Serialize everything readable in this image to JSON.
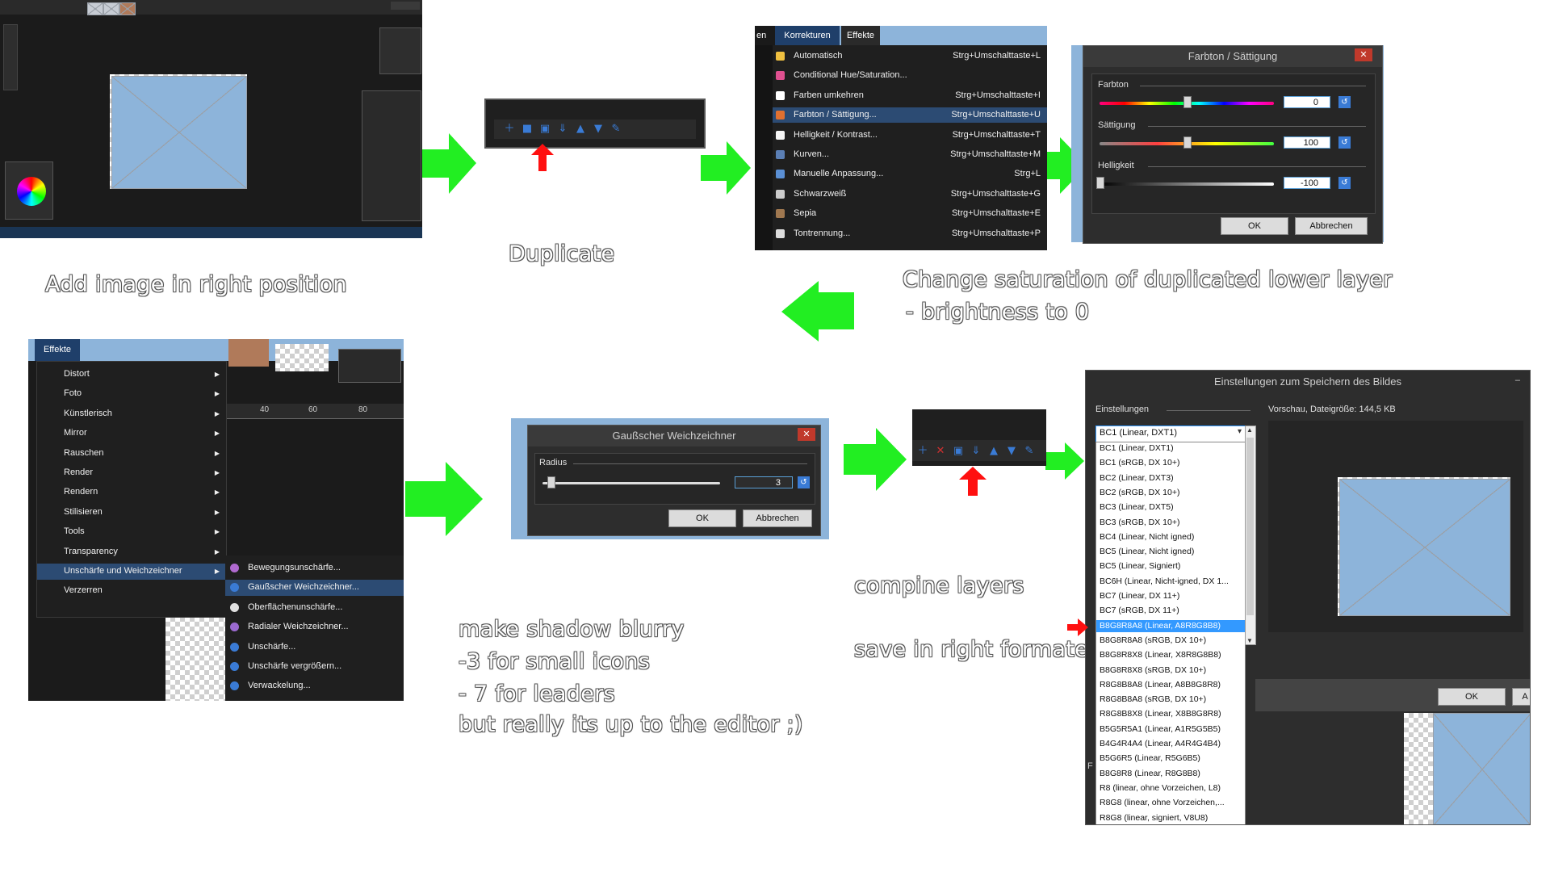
{
  "captions": {
    "add_image": "Add image in right position",
    "duplicate": "Duplicate",
    "change_saturation_1": "Change saturation of duplicated lower layer",
    "change_saturation_2": "- brightness to 0",
    "blur_1": "make shadow blurry",
    "blur_2": "-3 for small icons",
    "blur_3": "- 7 for leaders",
    "blur_4": "but really its up to the editor ;)",
    "combine": "compine layers",
    "save": "save in right formate"
  },
  "corrections_menu": {
    "tabs": [
      "en",
      "Korrekturen",
      "Effekte"
    ],
    "items": [
      {
        "label": "Automatisch",
        "shortcut": "Strg+Umschalttaste+L",
        "icon": "auto-level-icon",
        "color": "#f0c040"
      },
      {
        "label": "Conditional Hue/Saturation...",
        "shortcut": "",
        "icon": "color-wheel-icon",
        "color": "#e05090"
      },
      {
        "label": "Farben umkehren",
        "shortcut": "Strg+Umschalttaste+I",
        "icon": "invert-icon",
        "color": "#ffffff"
      },
      {
        "label": "Farbton / Sättigung...",
        "shortcut": "Strg+Umschalttaste+U",
        "icon": "hue-icon",
        "color": "#e07030"
      },
      {
        "label": "Helligkeit / Kontrast...",
        "shortcut": "Strg+Umschalttaste+T",
        "icon": "sun-icon",
        "color": "#f5f5f5"
      },
      {
        "label": "Kurven...",
        "shortcut": "Strg+Umschalttaste+M",
        "icon": "curves-icon",
        "color": "#5b7fb5"
      },
      {
        "label": "Manuelle Anpassung...",
        "shortcut": "Strg+L",
        "icon": "levels-icon",
        "color": "#5b90d5"
      },
      {
        "label": "Schwarzweiß",
        "shortcut": "Strg+Umschalttaste+G",
        "icon": "bw-icon",
        "color": "#cccccc"
      },
      {
        "label": "Sepia",
        "shortcut": "Strg+Umschalttaste+E",
        "icon": "sepia-icon",
        "color": "#a07850"
      },
      {
        "label": "Tontrennung...",
        "shortcut": "Strg+Umschalttaste+P",
        "icon": "posterize-icon",
        "color": "#dddddd"
      }
    ],
    "highlighted_index": 3
  },
  "hue_dialog": {
    "title": "Farbton / Sättigung",
    "close": "✕",
    "hue_label": "Farbton",
    "hue_value": "0",
    "hue_level": 0.5,
    "sat_label": "Sättigung",
    "sat_value": "100",
    "sat_level": 0.5,
    "light_label": "Helligkeit",
    "light_value": "-100",
    "light_level": 0.0,
    "ok": "OK",
    "cancel": "Abbrechen"
  },
  "effects_menu": {
    "tab": "Effekte",
    "items": [
      "Distort",
      "Foto",
      "Künstlerisch",
      "Mirror",
      "Rauschen",
      "Render",
      "Rendern",
      "Stilisieren",
      "Tools",
      "Transparency",
      "Unschärfe und Weichzeichner",
      "Verzerren"
    ],
    "highlighted_index": 10,
    "ruler": [
      "40",
      "60",
      "80"
    ]
  },
  "blur_submenu": {
    "items": [
      {
        "label": "Bewegungsunschärfe...",
        "icon": "motion-blur-icon"
      },
      {
        "label": "Gaußscher Weichzeichner...",
        "icon": "drop-icon"
      },
      {
        "label": "Oberflächenunschärfe...",
        "icon": "surface-blur-icon"
      },
      {
        "label": "Radialer Weichzeichner...",
        "icon": "radial-blur-icon"
      },
      {
        "label": "Unschärfe...",
        "icon": "unfocus-icon"
      },
      {
        "label": "Unschärfe vergrößern...",
        "icon": "zoom-blur-icon"
      },
      {
        "label": "Verwackelung...",
        "icon": "fragment-icon"
      }
    ],
    "highlighted_index": 1
  },
  "gauss_dialog": {
    "title": "Gaußscher Weichzeichner",
    "close": "✕",
    "radius_label": "Radius",
    "radius_value": "3",
    "ok": "OK",
    "cancel": "Abbrechen"
  },
  "save_dialog": {
    "title": "Einstellungen zum Speichern des Bildes",
    "minimize": "–",
    "settings_label": "Einstellungen",
    "preview_label": "Vorschau, Dateigröße: 144,5 KB",
    "selected": "BC1 (Linear, DXT1)",
    "formats": [
      "BC1 (Linear, DXT1)",
      "BC1 (sRGB, DX 10+)",
      "BC2 (Linear, DXT3)",
      "BC2 (sRGB, DX 10+)",
      "BC3 (Linear, DXT5)",
      "BC3 (sRGB, DX 10+)",
      "BC4 (Linear, Nicht igned)",
      "BC5 (Linear, Nicht igned)",
      "BC5 (Linear, Signiert)",
      "BC6H (Linear, Nicht-igned, DX 1...",
      "BC7 (Linear, DX 11+)",
      "BC7 (sRGB, DX 11+)",
      "B8G8R8A8 (Linear, A8R8G8B8)",
      "B8G8R8A8 (sRGB, DX 10+)",
      "B8G8R8X8 (Linear, X8R8G8B8)",
      "B8G8R8X8 (sRGB, DX 10+)",
      "R8G8B8A8 (Linear, A8B8G8R8)",
      "R8G8B8A8 (sRGB, DX 10+)",
      "R8G8B8X8 (Linear, X8B8G8R8)",
      "B5G5R5A1 (Linear, A1R5G5B5)",
      "B4G4R4A4 (Linear, A4R4G4B4)",
      "B5G6R5 (Linear, R5G6B5)",
      "B8G8R8 (Linear, R8G8B8)",
      "R8 (linear, ohne Vorzeichen, L8)",
      "R8G8 (linear, ohne Vorzeichen,...",
      "R8G8 (linear, signiert, V8U8)"
    ],
    "highlighted_index": 12,
    "ok": "OK",
    "cancel_partial": "A",
    "side_letter": "F"
  },
  "colors": {
    "arrow_green": "#22ee22",
    "pointer_red": "#ff1010",
    "highlight_blue": "#2c4b73",
    "list_highlight": "#3399ff"
  }
}
